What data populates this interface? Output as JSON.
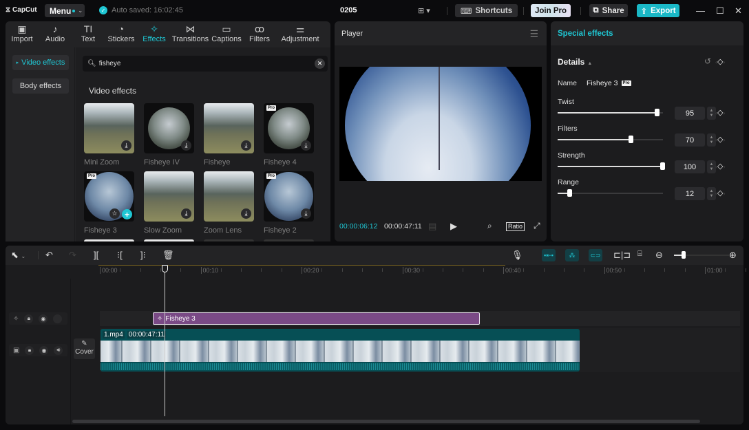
{
  "app": {
    "name": "CapCut",
    "project_title": "0205",
    "autosave": "Auto saved: 16:02:45"
  },
  "titlebar": {
    "menu_label": "Menu",
    "shortcuts_label": "Shortcuts",
    "joinpro_label": "Join Pro",
    "share_label": "Share",
    "export_label": "Export",
    "icons": {
      "layout": "layout-icon",
      "minimize": "minimize-icon",
      "maximize": "maximize-icon",
      "close": "close-icon"
    }
  },
  "nav": {
    "active": "Effects",
    "items": [
      {
        "label": "Import",
        "icon": "▣"
      },
      {
        "label": "Audio",
        "icon": "♪"
      },
      {
        "label": "Text",
        "icon": "TI"
      },
      {
        "label": "Stickers",
        "icon": "◔"
      },
      {
        "label": "Effects",
        "icon": "✧"
      },
      {
        "label": "Transitions",
        "icon": "⋈"
      },
      {
        "label": "Captions",
        "icon": "▭"
      },
      {
        "label": "Filters",
        "icon": "ꝏ"
      },
      {
        "label": "Adjustment",
        "icon": "⚌"
      }
    ]
  },
  "sidebar": {
    "items": [
      {
        "label": "Video effects",
        "active": true
      },
      {
        "label": "Body effects",
        "active": false
      }
    ]
  },
  "search": {
    "value": "fisheye",
    "placeholder": "Search"
  },
  "effects": {
    "section_title": "Video effects",
    "items": [
      {
        "label": "Mini Zoom",
        "pro": false
      },
      {
        "label": "Fisheye IV",
        "pro": false
      },
      {
        "label": "Fisheye",
        "pro": false
      },
      {
        "label": "Fisheye 4",
        "pro": true
      },
      {
        "label": "Fisheye 3",
        "pro": true,
        "selected": true
      },
      {
        "label": "Slow Zoom",
        "pro": false
      },
      {
        "label": "Zoom Lens",
        "pro": false
      },
      {
        "label": "Fisheye 2",
        "pro": true
      }
    ],
    "pro_badge": "Pro"
  },
  "player": {
    "title": "Player",
    "current_time": "00:00:06:12",
    "total_time": "00:00:47:11",
    "ratio_label": "Ratio"
  },
  "special_effects": {
    "title": "Special effects",
    "details_label": "Details",
    "name_label": "Name",
    "name_value": "Fisheye 3",
    "pro_badge": "Pro",
    "params": [
      {
        "label": "Twist",
        "value": 95,
        "max": 100
      },
      {
        "label": "Filters",
        "value": 70,
        "max": 100
      },
      {
        "label": "Strength",
        "value": 100,
        "max": 100
      },
      {
        "label": "Range",
        "value": 12,
        "max": 100
      }
    ]
  },
  "timeline": {
    "ruler": [
      "00:00",
      "00:10",
      "00:20",
      "00:30",
      "00:40",
      "00:50",
      "01:00"
    ],
    "effect_clip": "Fisheye 3",
    "video_clip": {
      "name": "1.mp4",
      "duration": "00:00:47:11"
    },
    "cover_label": "Cover",
    "zoom_level": 0.18
  }
}
